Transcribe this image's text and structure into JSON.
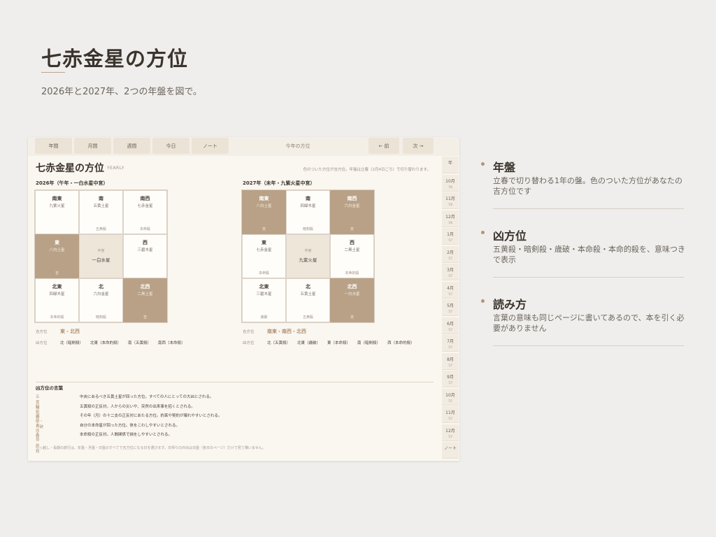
{
  "header": {
    "title": "七赤金星の方位",
    "subtitle": "2026年と2027年、2つの年盤を図で。"
  },
  "colors": {
    "accent": "#b39478",
    "good_cell": "#b9a187",
    "center_cell": "#efe6da",
    "background": "#efeeec"
  },
  "app": {
    "tabs": [
      "年間",
      "月間",
      "週間",
      "今日",
      "ノート"
    ],
    "tab_title": "今年の方位",
    "prev_label": "← 前",
    "next_label": "次 →",
    "page_title": "七赤金星の方位",
    "page_tag": "YEARLY",
    "notice": "色のついた方位が吉方位。年盤は立春（2月4日ごろ）で切り替わります。",
    "side_tabs": [
      {
        "label": "年",
        "sub": ""
      },
      {
        "label": "10月",
        "sub": "'26"
      },
      {
        "label": "11月",
        "sub": "'26"
      },
      {
        "label": "12月",
        "sub": "'26"
      },
      {
        "label": "1月",
        "sub": "'27"
      },
      {
        "label": "2月",
        "sub": "'27"
      },
      {
        "label": "3月",
        "sub": "'27"
      },
      {
        "label": "4月",
        "sub": "'27"
      },
      {
        "label": "5月",
        "sub": "'27"
      },
      {
        "label": "6月",
        "sub": "'27"
      },
      {
        "label": "7月",
        "sub": "'27"
      },
      {
        "label": "8月",
        "sub": "'27"
      },
      {
        "label": "9月",
        "sub": "'27"
      },
      {
        "label": "10月",
        "sub": "'27"
      },
      {
        "label": "11月",
        "sub": "'27"
      },
      {
        "label": "12月",
        "sub": "'27"
      },
      {
        "label": "ノート",
        "sub": ""
      }
    ],
    "boards": [
      {
        "title": "2026年（午年・一白水星中宮）",
        "cells": [
          {
            "dir": "南東",
            "star": "九紫火星",
            "tag": "",
            "good": false
          },
          {
            "dir": "南",
            "star": "五黄土星",
            "tag": "五黄殺",
            "good": false
          },
          {
            "dir": "南西",
            "star": "七赤金星",
            "tag": "本命殺",
            "good": false
          },
          {
            "dir": "東",
            "star": "八白土星",
            "tag": "吉",
            "good": true
          },
          {
            "dir": "中宮",
            "star": "一白水星",
            "tag": "",
            "good": false,
            "center": true
          },
          {
            "dir": "西",
            "star": "三碧木星",
            "tag": "",
            "good": false
          },
          {
            "dir": "北東",
            "star": "四緑木星",
            "tag": "本命的殺",
            "good": false
          },
          {
            "dir": "北",
            "star": "六白金星",
            "tag": "暗剣殺",
            "good": false
          },
          {
            "dir": "北西",
            "star": "二黒土星",
            "tag": "吉",
            "good": true
          }
        ],
        "kichi_label": "吉方位",
        "kichi": "東・北西",
        "kyou_label": "凶方位",
        "kyou": [
          "北（暗剣殺）",
          "北東（本命的殺）",
          "南（五黄殺）",
          "南西（本命殺）"
        ]
      },
      {
        "title": "2027年（未年・九紫火星中宮）",
        "cells": [
          {
            "dir": "南東",
            "star": "八白土星",
            "tag": "吉",
            "good": true
          },
          {
            "dir": "南",
            "star": "四緑木星",
            "tag": "暗剣殺",
            "good": false
          },
          {
            "dir": "南西",
            "star": "六白金星",
            "tag": "吉",
            "good": true
          },
          {
            "dir": "東",
            "star": "七赤金星",
            "tag": "本命殺",
            "good": false
          },
          {
            "dir": "中宮",
            "star": "九紫火星",
            "tag": "",
            "good": false,
            "center": true
          },
          {
            "dir": "西",
            "star": "二黒土星",
            "tag": "本命的殺",
            "good": false
          },
          {
            "dir": "北東",
            "star": "三碧木星",
            "tag": "歳破",
            "good": false
          },
          {
            "dir": "北",
            "star": "五黄土星",
            "tag": "五黄殺",
            "good": false
          },
          {
            "dir": "北西",
            "star": "一白水星",
            "tag": "吉",
            "good": true
          }
        ],
        "kichi_label": "吉方位",
        "kichi": "南東・南西・北西",
        "kyou_label": "凶方位",
        "kyou": [
          "北（五黄殺）",
          "北東（歳破）",
          "東（本命殺）",
          "南（暗剣殺）",
          "西（本命的殺）"
        ]
      }
    ],
    "glossary_title": "凶方位の言葉",
    "glossary": [
      {
        "term": "五黄殺",
        "desc": "中央にあるべき五黄土星が回った方位。すべての人にとっての大凶とされる。"
      },
      {
        "term": "暗剣殺",
        "desc": "五黄殺の正反対。人からの災いや、突然の出来事を招くとされる。"
      },
      {
        "term": "歳破・月破",
        "desc": "その年（月）の十二支の正反対にあたる方位。約束や契約が壊れやすいとされる。"
      },
      {
        "term": "本命殺",
        "desc": "自分の本命星が回った方位。体をこわしやすいとされる。"
      },
      {
        "term": "本命的殺",
        "desc": "本命殺の正反対。人間関係で損をしやすいとされる。"
      }
    ],
    "footnote": "引っ越し・長期の旅行は、年盤・月盤・日盤のすべてで吉方位になる日を選びます。日帰りの外出は日盤（各日のページ）だけで見て構いません。"
  },
  "features": [
    {
      "title": "年盤",
      "desc": "立春で切り替わる1年の盤。色のついた方位があなたの吉方位です"
    },
    {
      "title": "凶方位",
      "desc": "五黄殺・暗剣殺・歳破・本命殺・本命的殺を、意味つきで表示"
    },
    {
      "title": "読み方",
      "desc": "言葉の意味も同じページに書いてあるので、本を引く必要がありません"
    }
  ]
}
